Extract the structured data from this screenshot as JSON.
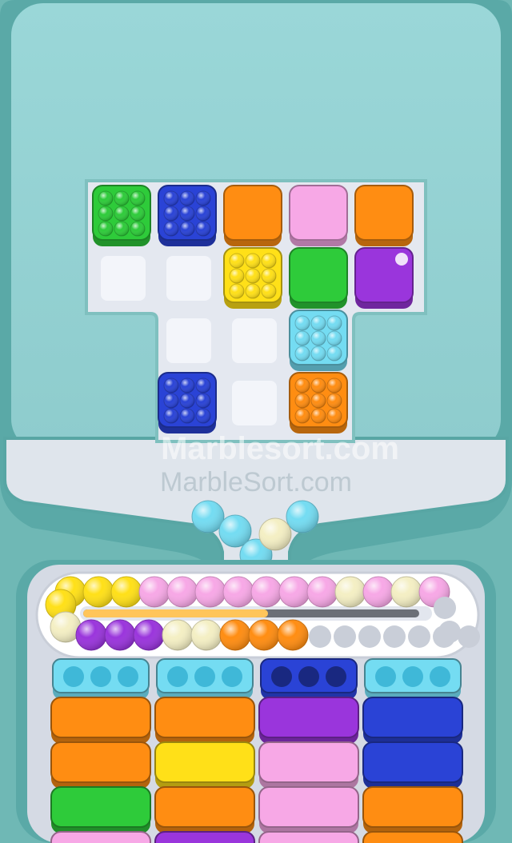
{
  "watermarks": [
    "Marblesort.com",
    "MarbleSort.com"
  ],
  "colors": {
    "background": "#6fb8b5",
    "board_surface": "#e4e8f0",
    "green": "#2ecb3a",
    "blue": "#2a43d6",
    "orange": "#ff8d12",
    "pink": "#f7a8e6",
    "yellow": "#ffe018",
    "purple": "#9a35dc",
    "cyan": "#74dcf2",
    "cream": "#f4efc4"
  },
  "board": {
    "rows": [
      [
        {
          "color": "green",
          "marbles": true
        },
        {
          "color": "blue",
          "marbles": true
        },
        {
          "color": "orange",
          "marbles": false
        },
        {
          "color": "pink",
          "marbles": false
        },
        {
          "color": "orange",
          "marbles": false
        }
      ],
      [
        {
          "color": "empty"
        },
        {
          "color": "empty"
        },
        {
          "color": "yellow",
          "marbles": true
        },
        {
          "color": "green",
          "marbles": false
        },
        {
          "color": "purple",
          "marbles": false,
          "marker": true
        }
      ],
      [
        null,
        {
          "color": "empty"
        },
        {
          "color": "empty"
        },
        {
          "color": "cyan",
          "marbles": true
        },
        null
      ],
      [
        null,
        {
          "color": "blue",
          "marbles": true
        },
        {
          "color": "empty"
        },
        {
          "color": "orange",
          "marbles": true
        },
        null
      ]
    ]
  },
  "falling_marbles": [
    "cyan",
    "cyan",
    "cyan",
    "cyan",
    "cream"
  ],
  "conveyor": {
    "top_row": [
      "yellow",
      "yellow",
      "yellow",
      "pink",
      "pink",
      "pink",
      "pink",
      "pink",
      "pink",
      "pink",
      "cream",
      "pink",
      "cream",
      "pink"
    ],
    "left_column": [
      "yellow",
      "cream"
    ],
    "bottom_row": [
      "purple",
      "purple",
      "purple",
      "cream",
      "cream",
      "orange",
      "orange",
      "orange"
    ],
    "empty_slots": 7,
    "progress": 0.55
  },
  "columns": [
    {
      "tray": "cyan",
      "tray_dark": false,
      "blocks": [
        "orange",
        "orange",
        "green",
        "pink"
      ]
    },
    {
      "tray": "cyan",
      "tray_dark": false,
      "blocks": [
        "orange",
        "yellow",
        "orange",
        "purple"
      ]
    },
    {
      "tray": "blue",
      "tray_dark": true,
      "blocks": [
        "purple",
        "pink",
        "pink",
        "pink"
      ]
    },
    {
      "tray": "cyan",
      "tray_dark": false,
      "blocks": [
        "blue",
        "blue",
        "orange",
        "orange"
      ]
    }
  ]
}
